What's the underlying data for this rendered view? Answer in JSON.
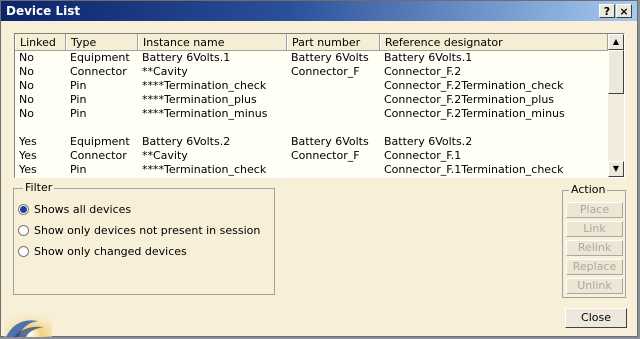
{
  "window": {
    "title": "Device List",
    "help_glyph": "?",
    "close_glyph": "×"
  },
  "table": {
    "columns": [
      "Linked",
      "Type",
      "Instance name",
      "Part number",
      "Reference designator"
    ],
    "rows": [
      [
        "No",
        "Equipment",
        "Battery 6Volts.1",
        "Battery 6Volts",
        "Battery 6Volts.1"
      ],
      [
        "No",
        "Connector",
        "**Cavity",
        "Connector_F",
        "Connector_F.2"
      ],
      [
        "No",
        "Pin",
        "****Termination_check",
        "",
        "Connector_F.2Termination_check"
      ],
      [
        "No",
        "Pin",
        "****Termination_plus",
        "",
        "Connector_F.2Termination_plus"
      ],
      [
        "No",
        "Pin",
        "****Termination_minus",
        "",
        "Connector_F.2Termination_minus"
      ],
      [
        "",
        "",
        "",
        "",
        ""
      ],
      [
        "Yes",
        "Equipment",
        "Battery 6Volts.2",
        "Battery 6Volts",
        "Battery 6Volts.2"
      ],
      [
        "Yes",
        "Connector",
        "**Cavity",
        "Connector_F",
        "Connector_F.1"
      ],
      [
        "Yes",
        "Pin",
        "****Termination_check",
        "",
        "Connector_F.1Termination_check"
      ]
    ],
    "scroll_up_glyph": "▲",
    "scroll_down_glyph": "▼"
  },
  "filter": {
    "legend": "Filter",
    "options": [
      {
        "label": "Shows all devices",
        "selected": true
      },
      {
        "label": "Show only devices not present in session",
        "selected": false
      },
      {
        "label": "Show only changed devices",
        "selected": false
      }
    ]
  },
  "action": {
    "legend": "Action",
    "buttons": [
      "Place",
      "Link",
      "Relink",
      "Replace",
      "Unlink"
    ],
    "disabled": true
  },
  "close_label": "Close",
  "colors": {
    "title_start": "#0b246a",
    "title_end": "#a6caf0",
    "dialog_bg": "#f7efd7"
  }
}
